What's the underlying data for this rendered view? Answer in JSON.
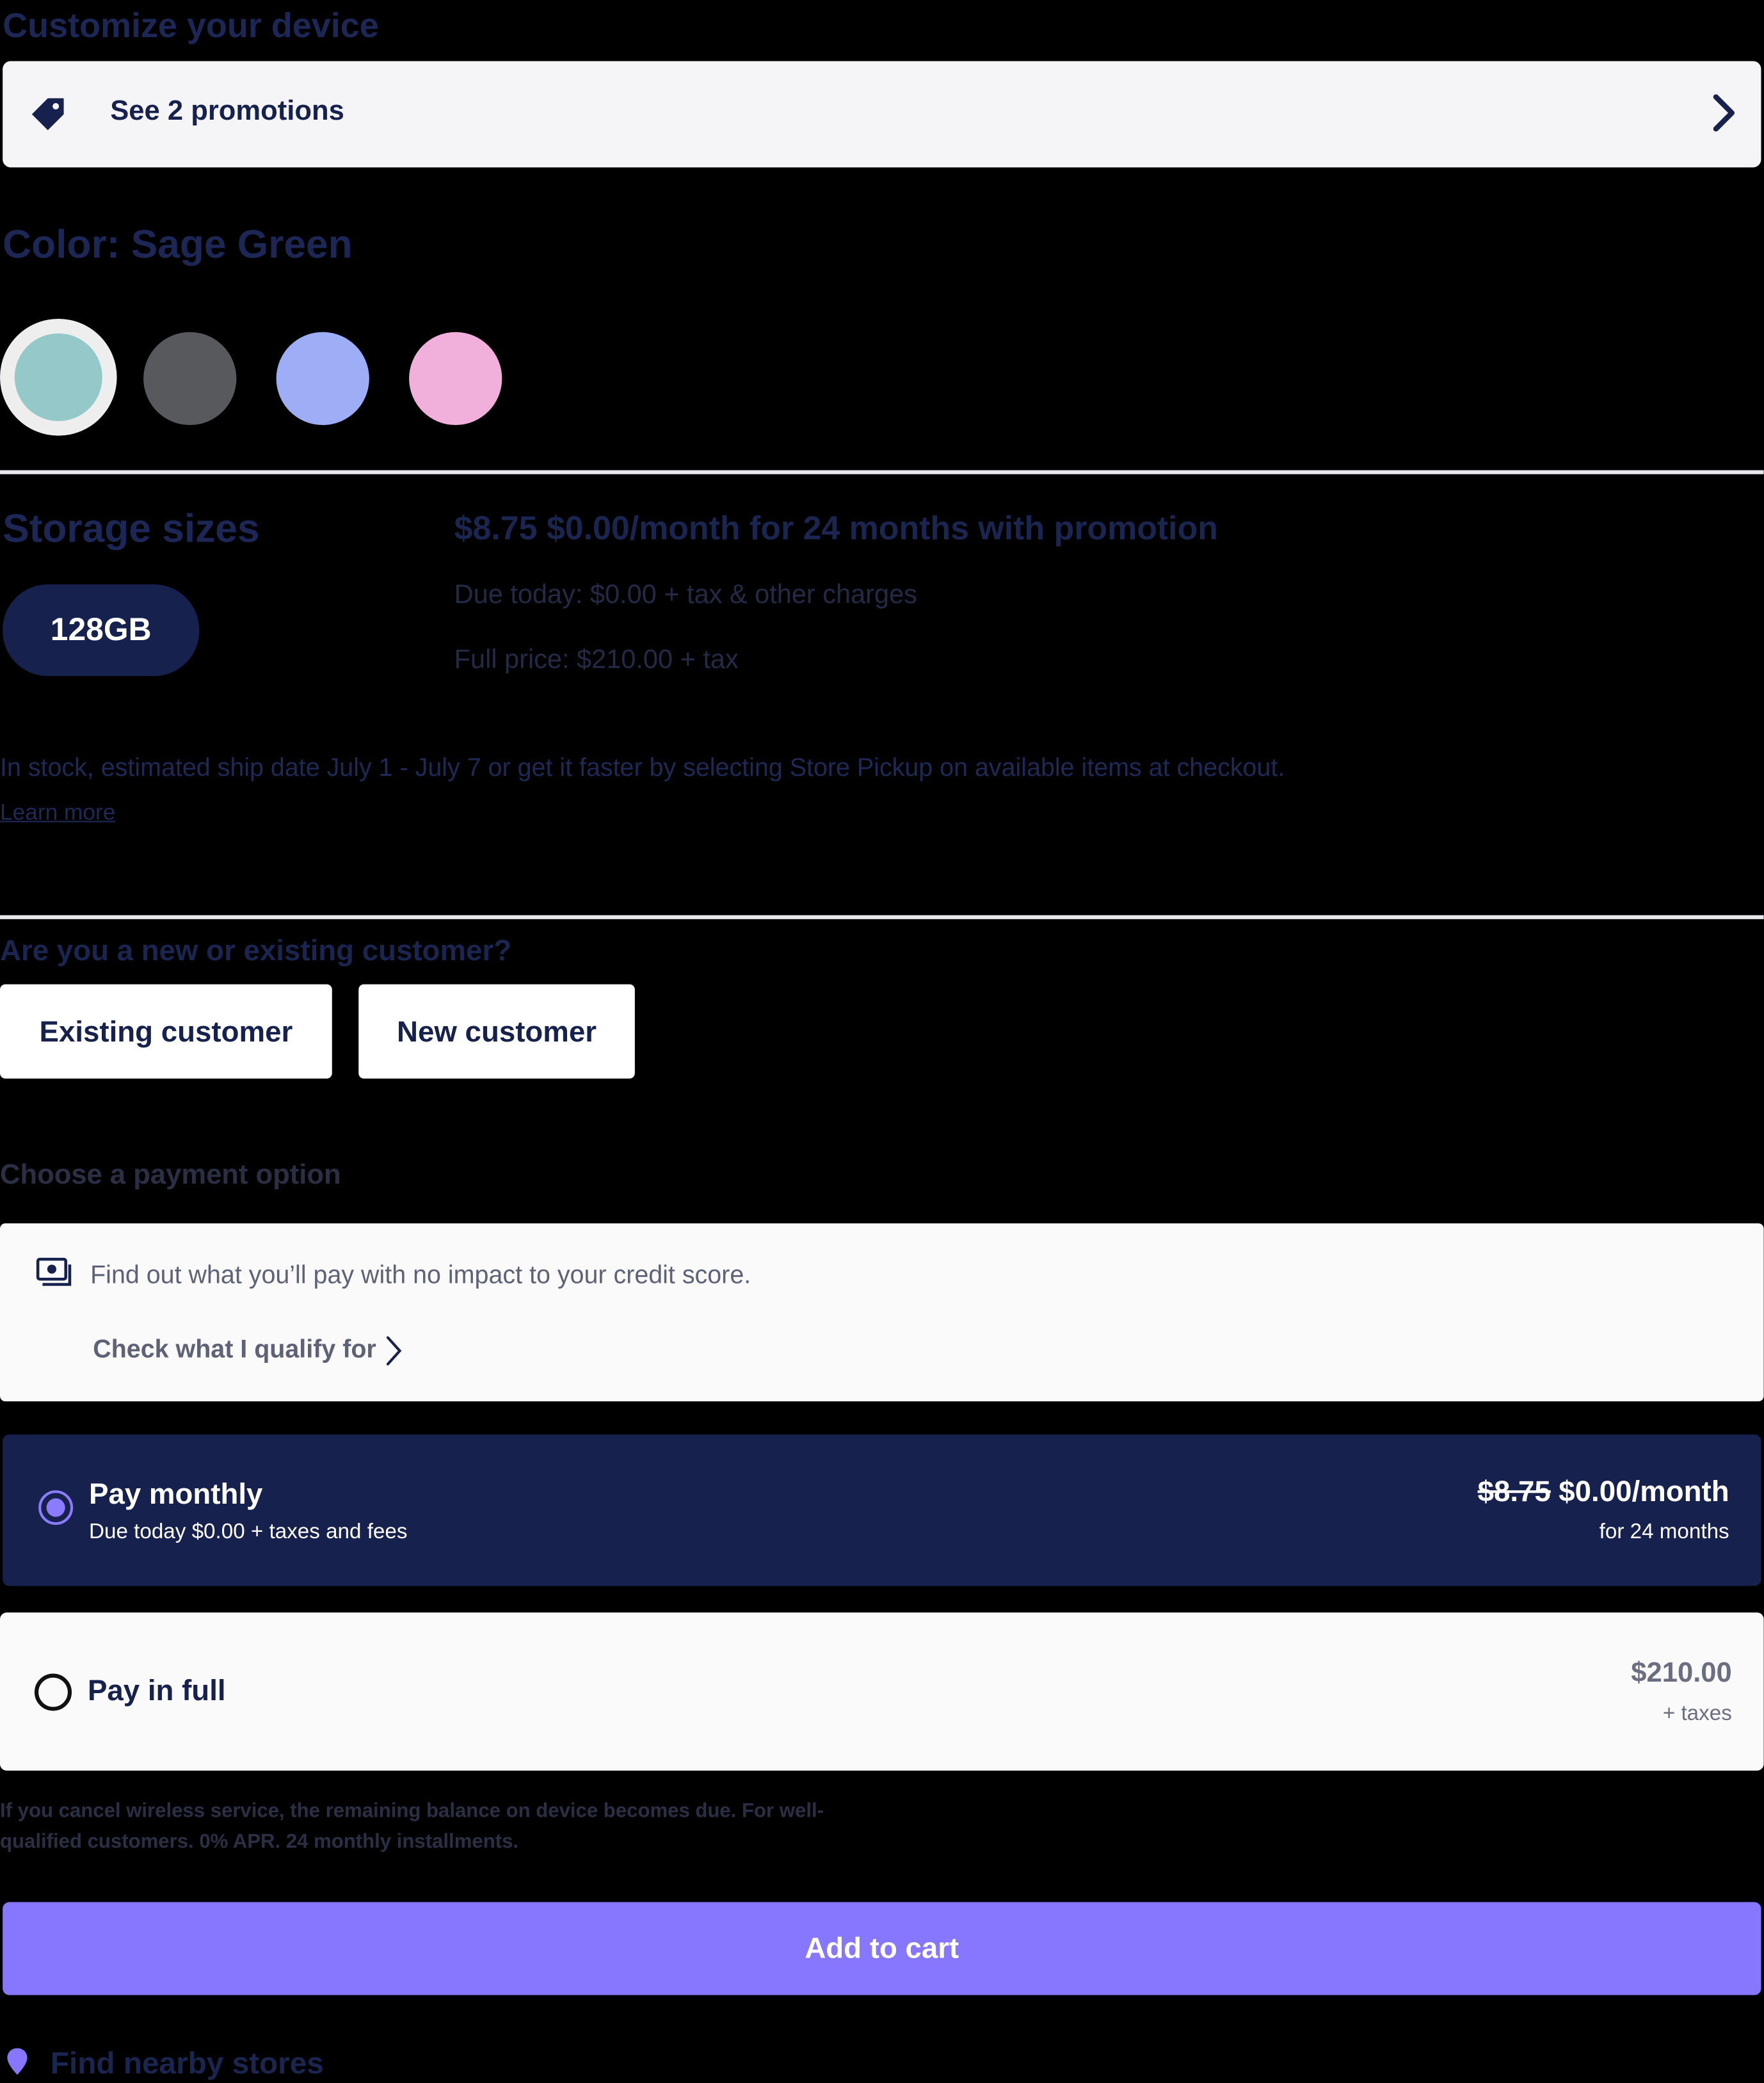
{
  "customize": {
    "heading": "Customize your device"
  },
  "promotions": {
    "label": "See 2 promotions",
    "icon": "tag-icon"
  },
  "color": {
    "heading": "Color: Sage Green",
    "swatches": [
      {
        "name": "Sage Green",
        "hex": "#95c8c8",
        "selected": true
      },
      {
        "name": "Dark Gray",
        "hex": "#58595d",
        "selected": false
      },
      {
        "name": "Periwinkle",
        "hex": "#9eaef6",
        "selected": false
      },
      {
        "name": "Pink",
        "hex": "#f1afdc",
        "selected": false
      }
    ]
  },
  "storage": {
    "heading": "Storage sizes",
    "option": "128GB",
    "price_line": "$8.75 $0.00/month for 24 months with promotion",
    "due_today": "Due today: $0.00 + tax & other charges",
    "full_price": "Full price: $210.00 + tax"
  },
  "shipping": {
    "text": "In stock, estimated ship date July 1 - July 7 or get it faster by selecting Store Pickup on available items at checkout.",
    "link": "Learn more"
  },
  "customer": {
    "question": "Are you a new or existing customer?",
    "existing_label": "Existing customer",
    "new_label": "New customer"
  },
  "payment": {
    "heading": "Choose a payment option",
    "credit_text": "Find out what you’ll pay with no impact to your credit score.",
    "credit_link": "Check what I qualify for",
    "monthly": {
      "title": "Pay monthly",
      "subtitle": "Due today $0.00 + taxes and fees",
      "old_price": "$8.75",
      "price": "$0.00/month",
      "term": "for 24 months"
    },
    "full": {
      "title": "Pay in full",
      "price": "$210.00",
      "taxes": "+ taxes"
    },
    "disclaimer_line1": "If you cancel wireless service, the remaining balance on device becomes due. For well-",
    "disclaimer_line2": "qualified customers. 0% APR. 24 monthly installments."
  },
  "cart": {
    "add_label": "Add to cart"
  },
  "stores": {
    "label": "Find nearby stores"
  },
  "colors": {
    "navy": "#16224d",
    "accent": "#8777ff",
    "background": "#000000"
  }
}
